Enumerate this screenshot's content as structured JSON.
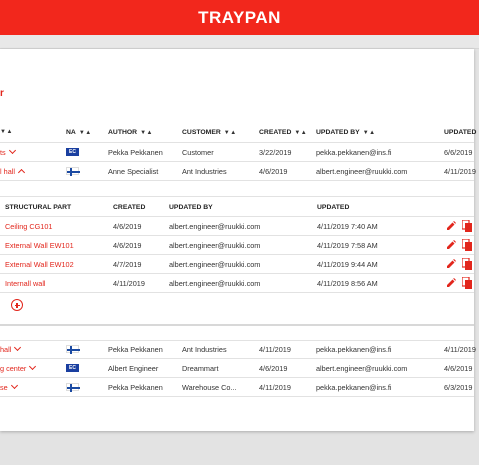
{
  "app": {
    "title": "TRAYPAN"
  },
  "section_mark": "r",
  "projects_table": {
    "columns": {
      "name_sort": "▼▲",
      "na": "NA",
      "author": "AUTHOR",
      "customer": "CUSTOMER",
      "created": "CREATED",
      "updated_by": "UPDATED BY",
      "updated": "UPDATED"
    },
    "sort_glyph": "▼▲",
    "rows_top": [
      {
        "name": "ts",
        "flag": "eu",
        "flag_label": "EC",
        "author": "Pekka Pekkanen",
        "customer": "Customer",
        "created": "3/22/2019",
        "updated_by": "pekka.pekkanen@ins.fi",
        "updated": "6/6/2019",
        "expanded": false
      },
      {
        "name": "l hall",
        "flag": "fi",
        "author": "Anne Specialist",
        "customer": "Ant Industries",
        "created": "4/6/2019",
        "updated_by": "albert.engineer@ruukki.com",
        "updated": "4/11/2019",
        "expanded": true
      }
    ],
    "rows_bottom": [
      {
        "name": "hall",
        "flag": "fi",
        "author": "Pekka Pekkanen",
        "customer": "Ant Industries",
        "created": "4/11/2019",
        "updated_by": "pekka.pekkanen@ins.fi",
        "updated": "4/11/2019"
      },
      {
        "name": "g center",
        "flag": "eu",
        "flag_label": "EC",
        "author": "Albert Engineer",
        "customer": "Dreammart",
        "created": "4/6/2019",
        "updated_by": "albert.engineer@ruukki.com",
        "updated": "4/6/2019"
      },
      {
        "name": "se",
        "flag": "fi",
        "author": "Pekka Pekkanen",
        "customer": "Warehouse Co...",
        "created": "4/11/2019",
        "updated_by": "pekka.pekkanen@ins.fi",
        "updated": "6/3/2019"
      }
    ]
  },
  "parts_table": {
    "columns": {
      "part": "STRUCTURAL PART",
      "created": "CREATED",
      "updated_by": "UPDATED BY",
      "updated": "UPDATED"
    },
    "rows": [
      {
        "part": "Ceiling CG101",
        "created": "4/6/2019",
        "updated_by": "albert.engineer@ruukki.com",
        "updated": "4/11/2019 7:40 AM"
      },
      {
        "part": "External Wall EW101",
        "created": "4/6/2019",
        "updated_by": "albert.engineer@ruukki.com",
        "updated": "4/11/2019 7:58 AM"
      },
      {
        "part": "External Wall EW102",
        "created": "4/7/2019",
        "updated_by": "albert.engineer@ruukki.com",
        "updated": "4/11/2019 9:44 AM"
      },
      {
        "part": "Internall wall",
        "created": "4/11/2019",
        "updated_by": "albert.engineer@ruukki.com",
        "updated": "4/11/2019 8:56 AM"
      }
    ]
  },
  "colors": {
    "brand_red": "#f2271c",
    "link_red": "#e2261c",
    "flag_blue": "#1b4aa2"
  }
}
